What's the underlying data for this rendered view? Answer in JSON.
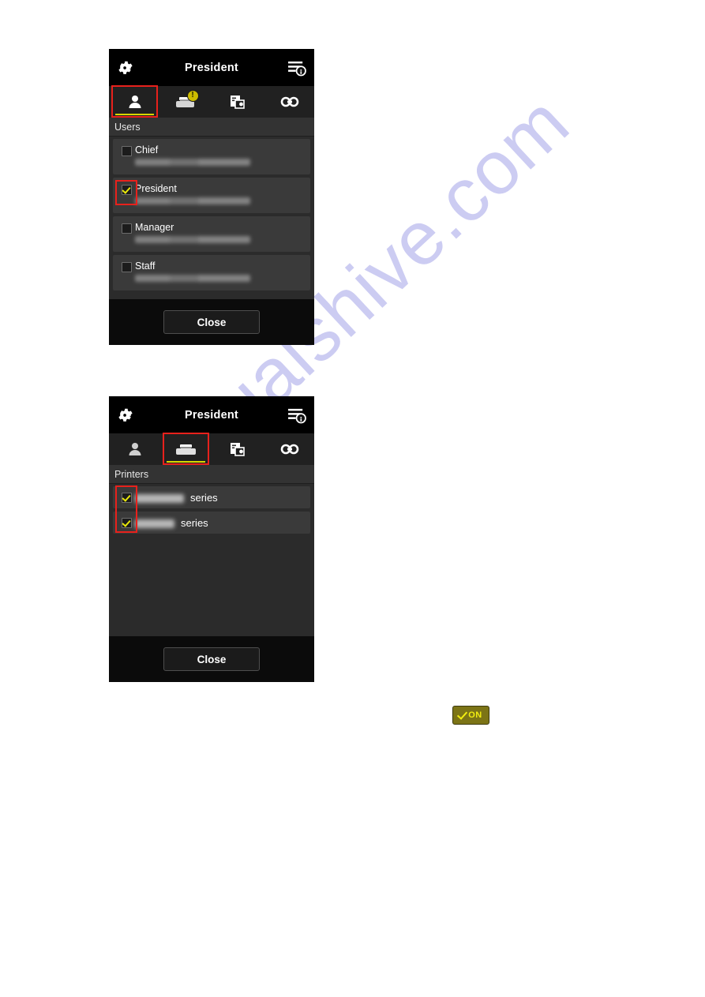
{
  "watermark": {
    "text": "manualshive.com"
  },
  "panels": [
    {
      "id": "users",
      "title": "President",
      "gear_icon": "gear-icon",
      "info_icon": "list-info-icon",
      "tabs": [
        {
          "icon": "user-icon",
          "label": "Users",
          "selected": true,
          "annotated": true,
          "badge": ""
        },
        {
          "icon": "printer-icon",
          "label": "Printers",
          "selected": false,
          "annotated": false,
          "badge": "!"
        },
        {
          "icon": "apps-settings-icon",
          "label": "Apps",
          "selected": false,
          "annotated": false,
          "badge": ""
        },
        {
          "icon": "link-icon",
          "label": "Link",
          "selected": false,
          "annotated": false,
          "badge": ""
        }
      ],
      "section_label": "Users",
      "rows": [
        {
          "name": "Chief",
          "checked": false,
          "email_redacted": true
        },
        {
          "name": "President",
          "checked": true,
          "email_redacted": true
        },
        {
          "name": "Manager",
          "checked": false,
          "email_redacted": true
        },
        {
          "name": "Staff",
          "checked": false,
          "email_redacted": true
        }
      ],
      "close_label": "Close"
    },
    {
      "id": "printers",
      "title": "President",
      "gear_icon": "gear-icon",
      "info_icon": "list-info-icon",
      "tabs": [
        {
          "icon": "user-icon",
          "label": "Users",
          "selected": false,
          "annotated": false,
          "badge": ""
        },
        {
          "icon": "printer-icon",
          "label": "Printers",
          "selected": true,
          "annotated": true,
          "badge": ""
        },
        {
          "icon": "apps-settings-icon",
          "label": "Apps",
          "selected": false,
          "annotated": false,
          "badge": ""
        },
        {
          "icon": "link-icon",
          "label": "Link",
          "selected": false,
          "annotated": false,
          "badge": ""
        }
      ],
      "section_label": "Printers",
      "rows": [
        {
          "name": "series",
          "checked": true,
          "model_redacted": true
        },
        {
          "name": "series",
          "checked": true,
          "model_redacted": true
        }
      ],
      "close_label": "Close"
    }
  ],
  "on_pill": {
    "label": "ON",
    "check_color": "#f2ee10",
    "bg_color": "#7c7416"
  },
  "colors": {
    "panel_bg": "#2b2b2b",
    "titlebar_bg": "#000000",
    "tabbar_bg": "#212121",
    "row_bg": "#3a3a3a",
    "accent_yellow": "#d8d800",
    "annotation_red": "#e8211c",
    "footer_bg": "#0b0b0b",
    "watermark": "#ccccf2"
  }
}
